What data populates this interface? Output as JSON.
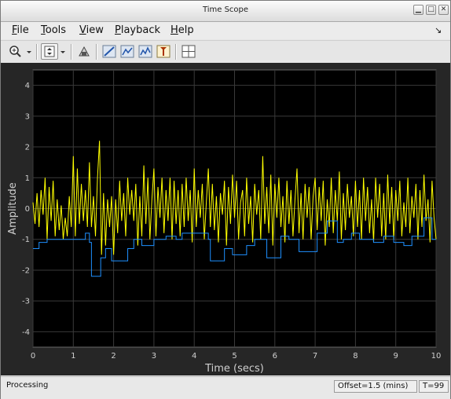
{
  "window": {
    "title": "Time Scope"
  },
  "menubar": {
    "items": [
      {
        "label": "File",
        "ul": "F",
        "rest": "ile"
      },
      {
        "label": "Tools",
        "ul": "T",
        "rest": "ools"
      },
      {
        "label": "View",
        "ul": "V",
        "rest": "iew"
      },
      {
        "label": "Playback",
        "ul": "P",
        "rest": "layback"
      },
      {
        "label": "Help",
        "ul": "H",
        "rest": "elp"
      }
    ],
    "dock_glyph": "↘"
  },
  "toolbar": {
    "icons": [
      "zoom-in-icon",
      "pan-scale-icon",
      "highlight-icon",
      "triggers-icon",
      "cursor-measurements-icon",
      "signal-statistics-icon",
      "peak-finder-icon",
      "bilevel-measurements-icon",
      "layout-icon"
    ]
  },
  "status": {
    "left": "Processing",
    "offset": "Offset=1.5 (mins)",
    "time": "T=99"
  },
  "colors": {
    "background": "#000000",
    "axes_area": "#262626",
    "grid": "#3a3a3a",
    "signal_yellow": "#ffff00",
    "signal_blue": "#1e90ff"
  },
  "chart_data": {
    "type": "line",
    "xlabel": "Time (secs)",
    "ylabel": "Amplitude",
    "xlim": [
      0,
      10
    ],
    "ylim": [
      -4.5,
      4.5
    ],
    "x_ticks": [
      "0",
      "1",
      "2",
      "3",
      "4",
      "5",
      "6",
      "7",
      "8",
      "9",
      "10"
    ],
    "y_ticks": [
      "4",
      "3",
      "2",
      "1",
      "0",
      "-1",
      "-2",
      "-3",
      "-4"
    ],
    "grid": true,
    "series": [
      {
        "color": "#ffff00",
        "style": "line",
        "points": [
          [
            0.0,
            0.2
          ],
          [
            0.05,
            -0.5
          ],
          [
            0.1,
            0.5
          ],
          [
            0.15,
            -0.6
          ],
          [
            0.2,
            0.6
          ],
          [
            0.25,
            -0.2
          ],
          [
            0.3,
            1.0
          ],
          [
            0.35,
            -1.0
          ],
          [
            0.4,
            0.7
          ],
          [
            0.45,
            -0.4
          ],
          [
            0.5,
            0.9
          ],
          [
            0.55,
            -0.9
          ],
          [
            0.6,
            0.3
          ],
          [
            0.65,
            -0.7
          ],
          [
            0.7,
            0.1
          ],
          [
            0.75,
            -1.0
          ],
          [
            0.8,
            -0.3
          ],
          [
            0.85,
            -0.9
          ],
          [
            0.9,
            0.4
          ],
          [
            0.95,
            -0.6
          ],
          [
            1.0,
            1.7
          ],
          [
            1.05,
            -0.9
          ],
          [
            1.1,
            1.3
          ],
          [
            1.15,
            -0.5
          ],
          [
            1.2,
            0.8
          ],
          [
            1.25,
            -0.4
          ],
          [
            1.3,
            0.6
          ],
          [
            1.35,
            -0.6
          ],
          [
            1.4,
            1.5
          ],
          [
            1.45,
            -0.6
          ],
          [
            1.5,
            0.4
          ],
          [
            1.55,
            -0.9
          ],
          [
            1.6,
            1.0
          ],
          [
            1.65,
            2.2
          ],
          [
            1.7,
            -1.5
          ],
          [
            1.75,
            0.5
          ],
          [
            1.8,
            -1.2
          ],
          [
            1.85,
            0.3
          ],
          [
            1.9,
            -0.6
          ],
          [
            1.95,
            0.4
          ],
          [
            2.0,
            -1.5
          ],
          [
            2.05,
            0.3
          ],
          [
            2.1,
            -0.8
          ],
          [
            2.15,
            0.9
          ],
          [
            2.2,
            -0.4
          ],
          [
            2.25,
            0.5
          ],
          [
            2.3,
            -0.9
          ],
          [
            2.35,
            1.0
          ],
          [
            2.4,
            -0.2
          ],
          [
            2.45,
            0.6
          ],
          [
            2.5,
            -0.4
          ],
          [
            2.55,
            0.8
          ],
          [
            2.6,
            -1.2
          ],
          [
            2.65,
            0.4
          ],
          [
            2.7,
            -0.9
          ],
          [
            2.75,
            1.4
          ],
          [
            2.8,
            -0.5
          ],
          [
            2.85,
            1.0
          ],
          [
            2.9,
            -1.0
          ],
          [
            2.95,
            0.3
          ],
          [
            3.0,
            1.3
          ],
          [
            3.05,
            -0.9
          ],
          [
            3.1,
            0.7
          ],
          [
            3.15,
            -0.3
          ],
          [
            3.2,
            1.0
          ],
          [
            3.25,
            -0.8
          ],
          [
            3.3,
            0.6
          ],
          [
            3.35,
            -0.4
          ],
          [
            3.4,
            1.0
          ],
          [
            3.45,
            -1.0
          ],
          [
            3.5,
            0.9
          ],
          [
            3.55,
            -0.5
          ],
          [
            3.6,
            0.6
          ],
          [
            3.65,
            -0.9
          ],
          [
            3.7,
            0.8
          ],
          [
            3.75,
            -0.6
          ],
          [
            3.8,
            1.0
          ],
          [
            3.85,
            -0.4
          ],
          [
            3.9,
            0.6
          ],
          [
            3.95,
            -1.1
          ],
          [
            4.0,
            1.3
          ],
          [
            4.05,
            -0.6
          ],
          [
            4.1,
            0.6
          ],
          [
            4.15,
            -0.3
          ],
          [
            4.2,
            0.8
          ],
          [
            4.25,
            -1.0
          ],
          [
            4.3,
            0.2
          ],
          [
            4.35,
            1.3
          ],
          [
            4.4,
            -0.6
          ],
          [
            4.45,
            0.8
          ],
          [
            4.5,
            -0.7
          ],
          [
            4.55,
            0.4
          ],
          [
            4.6,
            -1.1
          ],
          [
            4.65,
            0.5
          ],
          [
            4.7,
            -0.2
          ],
          [
            4.75,
            0.9
          ],
          [
            4.8,
            -1.2
          ],
          [
            4.85,
            0.7
          ],
          [
            4.9,
            -0.5
          ],
          [
            4.95,
            1.1
          ],
          [
            5.0,
            -0.3
          ],
          [
            5.05,
            0.9
          ],
          [
            5.1,
            -1.0
          ],
          [
            5.15,
            0.2
          ],
          [
            5.2,
            0.6
          ],
          [
            5.25,
            -0.9
          ],
          [
            5.3,
            1.0
          ],
          [
            5.35,
            -0.5
          ],
          [
            5.4,
            0.4
          ],
          [
            5.45,
            -1.1
          ],
          [
            5.5,
            0.8
          ],
          [
            5.55,
            -0.2
          ],
          [
            5.6,
            0.6
          ],
          [
            5.65,
            -1.0
          ],
          [
            5.7,
            1.7
          ],
          [
            5.75,
            -0.5
          ],
          [
            5.8,
            0.7
          ],
          [
            5.85,
            -0.8
          ],
          [
            5.9,
            1.1
          ],
          [
            5.95,
            -1.2
          ],
          [
            6.0,
            0.8
          ],
          [
            6.05,
            -0.3
          ],
          [
            6.1,
            1.0
          ],
          [
            6.15,
            -0.6
          ],
          [
            6.2,
            0.4
          ],
          [
            6.25,
            -1.1
          ],
          [
            6.3,
            0.9
          ],
          [
            6.35,
            -0.5
          ],
          [
            6.4,
            0.6
          ],
          [
            6.45,
            -0.9
          ],
          [
            6.5,
            0.3
          ],
          [
            6.55,
            1.3
          ],
          [
            6.6,
            -0.8
          ],
          [
            6.65,
            0.5
          ],
          [
            6.7,
            -1.0
          ],
          [
            6.75,
            0.8
          ],
          [
            6.8,
            -0.3
          ],
          [
            6.85,
            0.7
          ],
          [
            6.9,
            -1.0
          ],
          [
            6.95,
            0.4
          ],
          [
            7.0,
            1.0
          ],
          [
            7.05,
            -0.7
          ],
          [
            7.1,
            0.7
          ],
          [
            7.15,
            -0.4
          ],
          [
            7.2,
            0.9
          ],
          [
            7.25,
            -1.2
          ],
          [
            7.3,
            0.3
          ],
          [
            7.35,
            -0.6
          ],
          [
            7.4,
            1.0
          ],
          [
            7.45,
            -0.8
          ],
          [
            7.5,
            0.6
          ],
          [
            7.55,
            -0.4
          ],
          [
            7.6,
            1.2
          ],
          [
            7.65,
            -1.0
          ],
          [
            7.7,
            0.5
          ],
          [
            7.75,
            -0.7
          ],
          [
            7.8,
            0.8
          ],
          [
            7.85,
            -0.3
          ],
          [
            7.9,
            0.4
          ],
          [
            7.95,
            -0.9
          ],
          [
            8.0,
            0.9
          ],
          [
            8.05,
            -0.6
          ],
          [
            8.1,
            0.6
          ],
          [
            8.15,
            -1.0
          ],
          [
            8.2,
            1.0
          ],
          [
            8.25,
            -0.4
          ],
          [
            8.3,
            0.7
          ],
          [
            8.35,
            -0.8
          ],
          [
            8.4,
            0.3
          ],
          [
            8.45,
            -1.1
          ],
          [
            8.5,
            1.0
          ],
          [
            8.55,
            -0.3
          ],
          [
            8.6,
            0.8
          ],
          [
            8.65,
            -0.9
          ],
          [
            8.7,
            0.5
          ],
          [
            8.75,
            -1.0
          ],
          [
            8.8,
            1.1
          ],
          [
            8.85,
            -0.5
          ],
          [
            8.9,
            0.7
          ],
          [
            8.95,
            -1.0
          ],
          [
            9.0,
            0.6
          ],
          [
            9.05,
            -0.4
          ],
          [
            9.1,
            0.9
          ],
          [
            9.15,
            -0.9
          ],
          [
            9.2,
            0.2
          ],
          [
            9.25,
            -0.6
          ],
          [
            9.3,
            1.0
          ],
          [
            9.35,
            -0.8
          ],
          [
            9.4,
            0.4
          ],
          [
            9.45,
            -0.3
          ],
          [
            9.5,
            0.8
          ],
          [
            9.55,
            -1.0
          ],
          [
            9.6,
            0.6
          ],
          [
            9.65,
            -0.6
          ],
          [
            9.7,
            1.1
          ],
          [
            9.75,
            -0.4
          ],
          [
            9.8,
            0.3
          ],
          [
            9.85,
            -1.1
          ],
          [
            9.9,
            0.9
          ],
          [
            9.95,
            -0.3
          ],
          [
            10.0,
            -1.0
          ]
        ]
      },
      {
        "color": "#1e90ff",
        "style": "step",
        "points": [
          [
            0.0,
            -1.3
          ],
          [
            0.15,
            -1.1
          ],
          [
            0.35,
            -1.0
          ],
          [
            0.65,
            -1.0
          ],
          [
            0.9,
            -1.0
          ],
          [
            1.15,
            -1.0
          ],
          [
            1.3,
            -0.8
          ],
          [
            1.4,
            -1.1
          ],
          [
            1.45,
            -2.2
          ],
          [
            1.68,
            -1.6
          ],
          [
            1.8,
            -1.3
          ],
          [
            1.95,
            -1.7
          ],
          [
            2.35,
            -1.3
          ],
          [
            2.5,
            -1.0
          ],
          [
            2.7,
            -1.2
          ],
          [
            3.0,
            -1.0
          ],
          [
            3.3,
            -0.9
          ],
          [
            3.55,
            -1.0
          ],
          [
            3.7,
            -0.8
          ],
          [
            4.15,
            -0.8
          ],
          [
            4.35,
            -1.0
          ],
          [
            4.4,
            -1.7
          ],
          [
            4.75,
            -1.3
          ],
          [
            4.95,
            -1.5
          ],
          [
            5.3,
            -1.2
          ],
          [
            5.5,
            -1.0
          ],
          [
            5.8,
            -1.6
          ],
          [
            6.15,
            -0.9
          ],
          [
            6.35,
            -1.0
          ],
          [
            6.6,
            -1.4
          ],
          [
            7.05,
            -0.8
          ],
          [
            7.3,
            -0.4
          ],
          [
            7.55,
            -1.1
          ],
          [
            7.7,
            -1.0
          ],
          [
            7.9,
            -0.8
          ],
          [
            8.1,
            -1.0
          ],
          [
            8.25,
            -1.0
          ],
          [
            8.45,
            -1.1
          ],
          [
            8.7,
            -0.9
          ],
          [
            8.95,
            -1.1
          ],
          [
            9.2,
            -1.2
          ],
          [
            9.4,
            -0.9
          ],
          [
            9.7,
            -0.3
          ],
          [
            9.9,
            -1.0
          ],
          [
            10.0,
            -1.0
          ]
        ]
      }
    ]
  }
}
